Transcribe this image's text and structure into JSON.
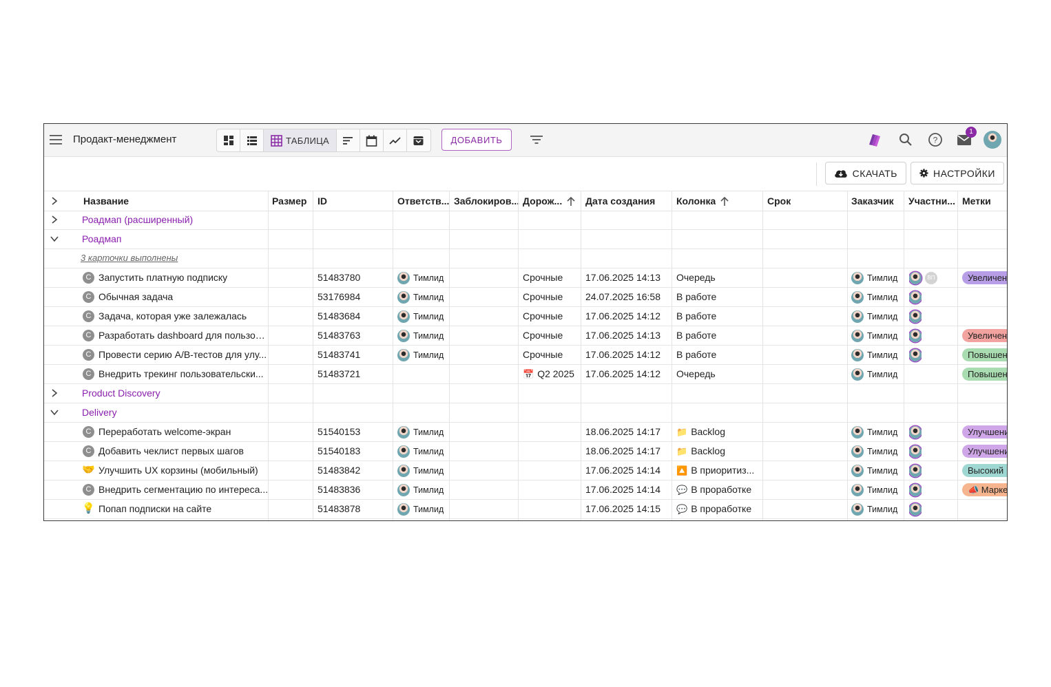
{
  "toolbar": {
    "title": "Продакт-менеджмент",
    "table_label": "ТАБЛИЦА",
    "add_label": "ДОБАВИТЬ",
    "notifications_count": "1"
  },
  "actions": {
    "download_label": "СКАЧАТЬ",
    "settings_label": "НАСТРОЙКИ"
  },
  "columns": [
    "Название",
    "Размер",
    "ID",
    "Ответств...",
    "Заблокиров...",
    "Дорож...",
    "Дата создания",
    "Колонка",
    "Срок",
    "Заказчик",
    "Участни...",
    "Метки"
  ],
  "groups": {
    "roadmap_ext": "Роадмап (расширенный)",
    "roadmap": "Роадмап",
    "done_note": "3 карточки выполнены",
    "discovery": "Product Discovery",
    "delivery": "Delivery"
  },
  "roadmap_rows": [
    {
      "icon": "C",
      "title": "Запустить платную подписку",
      "id": "51483780",
      "resp": "Тимлид",
      "road": "Срочные",
      "date": "17.06.2025 14:13",
      "col": "Очередь",
      "cust": "Тимлид",
      "tag": "Увеличени",
      "tag_color": "#b79ee6"
    },
    {
      "icon": "C",
      "title": "Обычная задача",
      "id": "53176984",
      "resp": "Тимлид",
      "road": "Срочные",
      "date": "24.07.2025 16:58",
      "col": "В работе",
      "cust": "Тимлид",
      "tag": "",
      "tag_color": ""
    },
    {
      "icon": "C",
      "title": "Задача, которая уже залежалась",
      "id": "51483684",
      "resp": "Тимлид",
      "road": "Срочные",
      "date": "17.06.2025 14:12",
      "col": "В работе",
      "cust": "Тимлид",
      "tag": "",
      "tag_color": ""
    },
    {
      "icon": "C",
      "title": "Разработать dashboard для пользова...",
      "id": "51483763",
      "resp": "Тимлид",
      "road": "Срочные",
      "date": "17.06.2025 14:13",
      "col": "В работе",
      "cust": "Тимлид",
      "tag": "Увеличени",
      "tag_color": "#f2a3a0"
    },
    {
      "icon": "C",
      "title": "Провести серию A/B-тестов для улу...",
      "id": "51483741",
      "resp": "Тимлид",
      "road": "Срочные",
      "date": "17.06.2025 14:12",
      "col": "В работе",
      "cust": "Тимлид",
      "tag": "Повышени",
      "tag_color": "#a9dcb0"
    },
    {
      "icon": "C",
      "title": "Внедрить трекинг пользовательски...",
      "id": "51483721",
      "resp": "",
      "road": "Q2 2025",
      "date": "17.06.2025 14:12",
      "col": "Очередь",
      "cust": "Тимлид",
      "tag": "Повышени",
      "tag_color": "#a9dcb0"
    }
  ],
  "delivery_rows": [
    {
      "icon": "C",
      "title": "Переработать welcome-экран",
      "id": "51540153",
      "resp": "Тимлид",
      "date": "18.06.2025 14:17",
      "col": "Backlog",
      "cust": "Тимлид",
      "tag": "Улучшени",
      "tag_color": "#cfa6e8"
    },
    {
      "icon": "C",
      "title": "Добавить чеклист первых шагов",
      "id": "51540183",
      "resp": "Тимлид",
      "date": "18.06.2025 14:17",
      "col": "Backlog",
      "cust": "Тимлид",
      "tag": "Улучшени",
      "tag_color": "#cfa6e8"
    },
    {
      "icon": "🤝",
      "title": "Улучшить UX корзины (мобильный)",
      "id": "51483842",
      "resp": "Тимлид",
      "date": "17.06.2025 14:14",
      "col": "В приоритиз...",
      "cust": "Тимлид",
      "tag": "Высокий",
      "tag_color": "#9fd8d3"
    },
    {
      "icon": "C",
      "title": "Внедрить сегментацию по интереса...",
      "id": "51483836",
      "resp": "Тимлид",
      "date": "17.06.2025 14:14",
      "col": "В проработке",
      "cust": "Тимлид",
      "tag": "📣 Марке",
      "tag_color": "#f6b48f"
    },
    {
      "icon": "💡",
      "title": "Попап подписки на сайте",
      "id": "51483878",
      "resp": "Тимлид",
      "date": "17.06.2025 14:15",
      "col": "В проработке",
      "cust": "Тимлид",
      "tag": "",
      "tag_color": ""
    }
  ],
  "icons": {
    "backlog": "📁",
    "priority": "🔼",
    "proработка": "💬",
    "roadmap_q": "📅"
  },
  "participant_initials": "ВП",
  "accent_color": "#8a1fae"
}
